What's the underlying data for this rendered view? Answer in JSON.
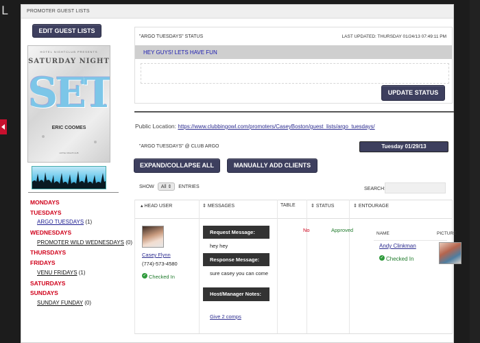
{
  "edge_letter": "L",
  "header": {
    "title": "PROMOTER GUEST LISTS"
  },
  "left": {
    "edit_button": "EDIT GUEST LISTS",
    "poster": {
      "line1": "HOTEL NIGHTCLUB PRESENTS",
      "line2": "SATURDAY NIGHT",
      "big": "SET",
      "dj": "ERIC COOMES",
      "footer": "HOTEL NIGHTCLUB"
    },
    "days": [
      {
        "day": "MONDAYS",
        "subs": []
      },
      {
        "day": "TUESDAYS",
        "subs": [
          {
            "name": "ARGO TUESDAYS",
            "count": "(1)",
            "link": true
          }
        ]
      },
      {
        "day": "WEDNESDAYS",
        "subs": [
          {
            "name": "PROMOTER WILD WEDNESDAYS",
            "count": "(0)",
            "link": false
          }
        ]
      },
      {
        "day": "THURSDAYS",
        "subs": []
      },
      {
        "day": "FRIDAYS",
        "subs": [
          {
            "name": "VENU FRIDAYS",
            "count": "(1)",
            "link": false
          }
        ]
      },
      {
        "day": "SATURDAYS",
        "subs": []
      },
      {
        "day": "SUNDAYS",
        "subs": [
          {
            "name": "SUNDAY FUNDAY",
            "count": "(0)",
            "link": false
          }
        ]
      }
    ]
  },
  "status": {
    "title": "\"ARGO TUESDAYS\" STATUS",
    "last_updated": "LAST UPDATED: THURSDAY 01/24/13 07:49:11 PM",
    "message": "HEY GUYS! LETS HAVE FUN",
    "input_value": "",
    "update_button": "UPDATE STATUS"
  },
  "public": {
    "label": "Public Location:",
    "url": "https://www.clubbingowl.com/promoters/CaseyBoston/guest_lists/argo_tuesdays/"
  },
  "event": {
    "club_line": "\"ARGO TUESDAYS\" @ CLUB ARGO",
    "date": "Tuesday 01/29/13"
  },
  "actions": {
    "expand": "EXPAND/COLLAPSE ALL",
    "add_clients": "MANUALLY ADD CLIENTS"
  },
  "table_controls": {
    "show": "SHOW",
    "select_value": "All",
    "entries": "ENTRIES",
    "search_label": "SEARCH:",
    "search_value": ""
  },
  "columns": [
    "HEAD USER",
    "MESSAGES",
    "TABLE",
    "STATUS",
    "ENTOURAGE"
  ],
  "row": {
    "head_user": {
      "name": "Casey Flynn",
      "phone": "(774)-573-4580",
      "checked_in": "Checked In"
    },
    "messages": {
      "request_label": "Request Message:",
      "request_text": "hey hey",
      "response_label": "Response Message:",
      "response_text": "sure casey you can come",
      "host_label": "Host/Manager Notes:",
      "host_text": "Give 2 comps"
    },
    "table": "No",
    "status": "Approved",
    "entourage": {
      "name_header": "NAME",
      "picture_header": "PICTURE",
      "name": "Andy Clinkman",
      "checked_in": "Checked In"
    }
  },
  "colors": {
    "accent_button": "#3d3f5e",
    "day_red": "#d0021b",
    "approved_green": "#1f7a2b",
    "link_blue": "#2b2b8f"
  }
}
